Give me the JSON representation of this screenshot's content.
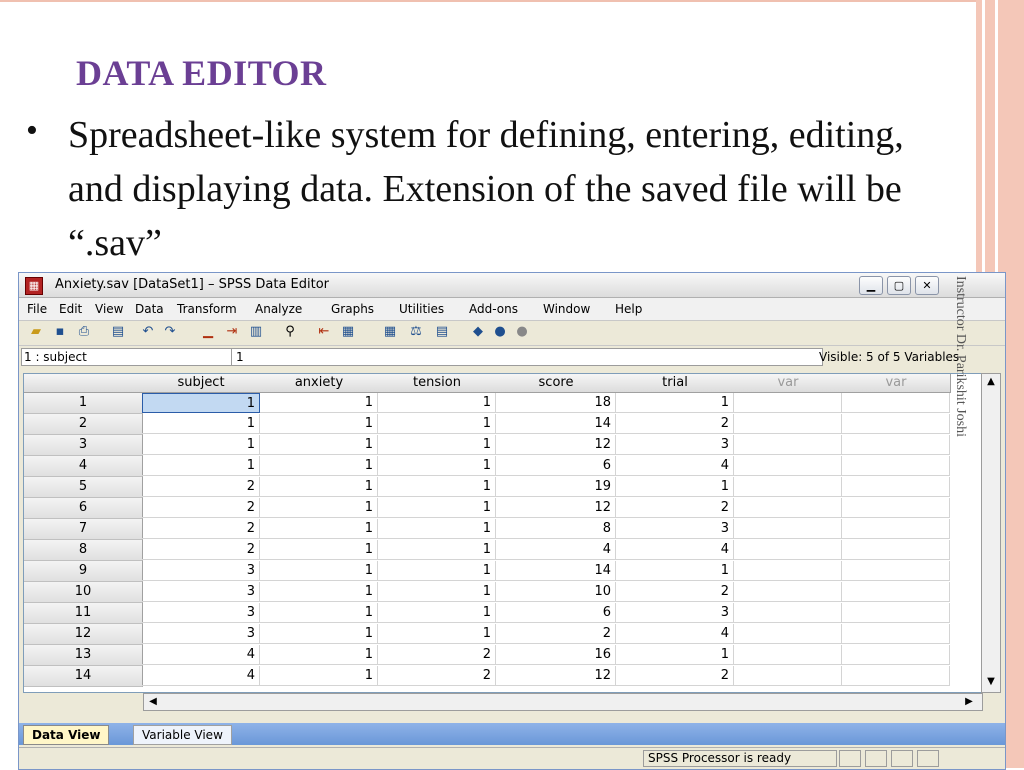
{
  "slide": {
    "title": "DATA EDITOR",
    "bullet": "•",
    "paragraph": "Spreadsheet-like system for defining, entering, editing, and displaying data. Extension of the saved file will be “.sav”",
    "vertical_note": "Instructor Dr. Parikshit Joshi"
  },
  "window": {
    "title": "Anxiety.sav [DataSet1] – SPSS Data Editor",
    "menu": [
      "File",
      "Edit",
      "View",
      "Data",
      "Transform",
      "Analyze",
      "Graphs",
      "Utilities",
      "Add-ons",
      "Window",
      "Help"
    ],
    "cell_ref": "1 : subject",
    "cell_value": "1",
    "visible": "Visible: 5 of 5 Variables"
  },
  "grid": {
    "columns": [
      "subject",
      "anxiety",
      "tension",
      "score",
      "trial",
      "var",
      "var"
    ],
    "rows": [
      [
        "1",
        "1",
        "1",
        "1",
        "18",
        "1"
      ],
      [
        "2",
        "1",
        "1",
        "1",
        "14",
        "2"
      ],
      [
        "3",
        "1",
        "1",
        "1",
        "12",
        "3"
      ],
      [
        "4",
        "1",
        "1",
        "1",
        "6",
        "4"
      ],
      [
        "5",
        "2",
        "1",
        "1",
        "19",
        "1"
      ],
      [
        "6",
        "2",
        "1",
        "1",
        "12",
        "2"
      ],
      [
        "7",
        "2",
        "1",
        "1",
        "8",
        "3"
      ],
      [
        "8",
        "2",
        "1",
        "1",
        "4",
        "4"
      ],
      [
        "9",
        "3",
        "1",
        "1",
        "14",
        "1"
      ],
      [
        "10",
        "3",
        "1",
        "1",
        "10",
        "2"
      ],
      [
        "11",
        "3",
        "1",
        "1",
        "6",
        "3"
      ],
      [
        "12",
        "3",
        "1",
        "1",
        "2",
        "4"
      ],
      [
        "13",
        "4",
        "1",
        "2",
        "16",
        "1"
      ],
      [
        "14",
        "4",
        "1",
        "2",
        "12",
        "2"
      ]
    ]
  },
  "tabs": [
    "Data View",
    "Variable View"
  ],
  "status": "SPSS  Processor is ready"
}
